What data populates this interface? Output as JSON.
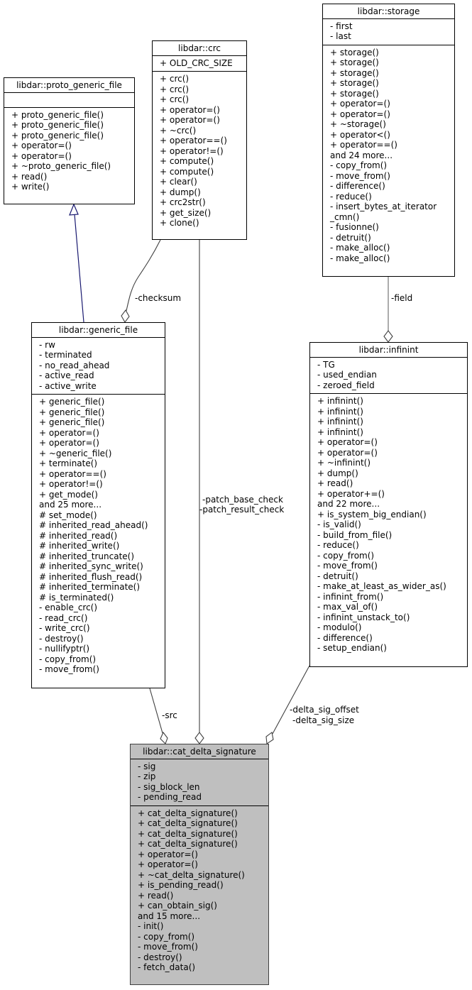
{
  "diagram": {
    "type": "class-collaboration",
    "classes": {
      "proto_generic_file": {
        "name": "libdar::proto_generic_file",
        "attributes": [],
        "methods": [
          "+ proto_generic_file()",
          "+ proto_generic_file()",
          "+ proto_generic_file()",
          "+ operator=()",
          "+ operator=()",
          "+ ~proto_generic_file()",
          "+ read()",
          "+ write()"
        ]
      },
      "crc": {
        "name": "libdar::crc",
        "attributes": [
          "+ OLD_CRC_SIZE"
        ],
        "methods": [
          "+ crc()",
          "+ crc()",
          "+ crc()",
          "+ operator=()",
          "+ operator=()",
          "+ ~crc()",
          "+ operator==()",
          "+ operator!=()",
          "+ compute()",
          "+ compute()",
          "+ clear()",
          "+ dump()",
          "+ crc2str()",
          "+ get_size()",
          "+ clone()"
        ]
      },
      "storage": {
        "name": "libdar::storage",
        "attributes": [
          "- first",
          "- last"
        ],
        "methods": [
          "+ storage()",
          "+ storage()",
          "+ storage()",
          "+ storage()",
          "+ storage()",
          "+ operator=()",
          "+ operator=()",
          "+ ~storage()",
          "+ operator<()",
          "+ operator==()",
          "and 24 more...",
          "- copy_from()",
          "- move_from()",
          "- difference()",
          "- reduce()",
          "- insert_bytes_at_iterator",
          "_cmn()",
          "- fusionne()",
          "- detruit()",
          "- make_alloc()",
          "- make_alloc()"
        ]
      },
      "generic_file": {
        "name": "libdar::generic_file",
        "attributes": [
          "- rw",
          "- terminated",
          "- no_read_ahead",
          "- active_read",
          "- active_write"
        ],
        "methods": [
          "+ generic_file()",
          "+ generic_file()",
          "+ generic_file()",
          "+ operator=()",
          "+ operator=()",
          "+ ~generic_file()",
          "+ terminate()",
          "+ operator==()",
          "+ operator!=()",
          "+ get_mode()",
          "and 25 more...",
          "# set_mode()",
          "# inherited_read_ahead()",
          "# inherited_read()",
          "# inherited_write()",
          "# inherited_truncate()",
          "# inherited_sync_write()",
          "# inherited_flush_read()",
          "# inherited_terminate()",
          "# is_terminated()",
          "- enable_crc()",
          "- read_crc()",
          "- write_crc()",
          "- destroy()",
          "- nullifyptr()",
          "- copy_from()",
          "- move_from()"
        ]
      },
      "infinint": {
        "name": "libdar::infinint",
        "attributes": [
          "- TG",
          "- used_endian",
          "- zeroed_field"
        ],
        "methods": [
          "+ infinint()",
          "+ infinint()",
          "+ infinint()",
          "+ infinint()",
          "+ operator=()",
          "+ operator=()",
          "+ ~infinint()",
          "+ dump()",
          "+ read()",
          "+ operator+=()",
          "and 22 more...",
          "+ is_system_big_endian()",
          "- is_valid()",
          "- build_from_file()",
          "- reduce()",
          "- copy_from()",
          "- move_from()",
          "- detruit()",
          "- make_at_least_as_wider_as()",
          "- infinint_from()",
          "- max_val_of()",
          "- infinint_unstack_to()",
          "- modulo()",
          "- difference()",
          "- setup_endian()"
        ]
      },
      "cat_delta_signature": {
        "name": "libdar::cat_delta_signature",
        "attributes": [
          "- sig",
          "- zip",
          "- sig_block_len",
          "- pending_read"
        ],
        "methods": [
          "+ cat_delta_signature()",
          "+ cat_delta_signature()",
          "+ cat_delta_signature()",
          "+ cat_delta_signature()",
          "+ operator=()",
          "+ operator=()",
          "+ ~cat_delta_signature()",
          "+ is_pending_read()",
          "+ read()",
          "+ can_obtain_sig()",
          "and 15 more...",
          "- init()",
          "- copy_from()",
          "- move_from()",
          "- destroy()",
          "- fetch_data()"
        ]
      }
    },
    "edges": {
      "inherit": {
        "from": "generic_file",
        "to": "proto_generic_file",
        "kind": "inheritance",
        "color": "#191970"
      },
      "checksum": {
        "from": "crc",
        "to": "generic_file",
        "kind": "aggregation",
        "label": "-checksum",
        "color": "#404040"
      },
      "patch": {
        "from": "crc",
        "to": "cat_delta_signature",
        "kind": "aggregation",
        "label1": "-patch_base_check",
        "label2": "-patch_result_check",
        "color": "#404040"
      },
      "field": {
        "from": "storage",
        "to": "infinint",
        "kind": "aggregation",
        "label": "-field",
        "color": "#404040"
      },
      "src": {
        "from": "generic_file",
        "to": "cat_delta_signature",
        "kind": "aggregation",
        "label": "-src",
        "color": "#404040"
      },
      "delta": {
        "from": "infinint",
        "to": "cat_delta_signature",
        "kind": "aggregation",
        "label1": "-delta_sig_offset",
        "label2": "-delta_sig_size",
        "color": "#404040"
      }
    }
  }
}
